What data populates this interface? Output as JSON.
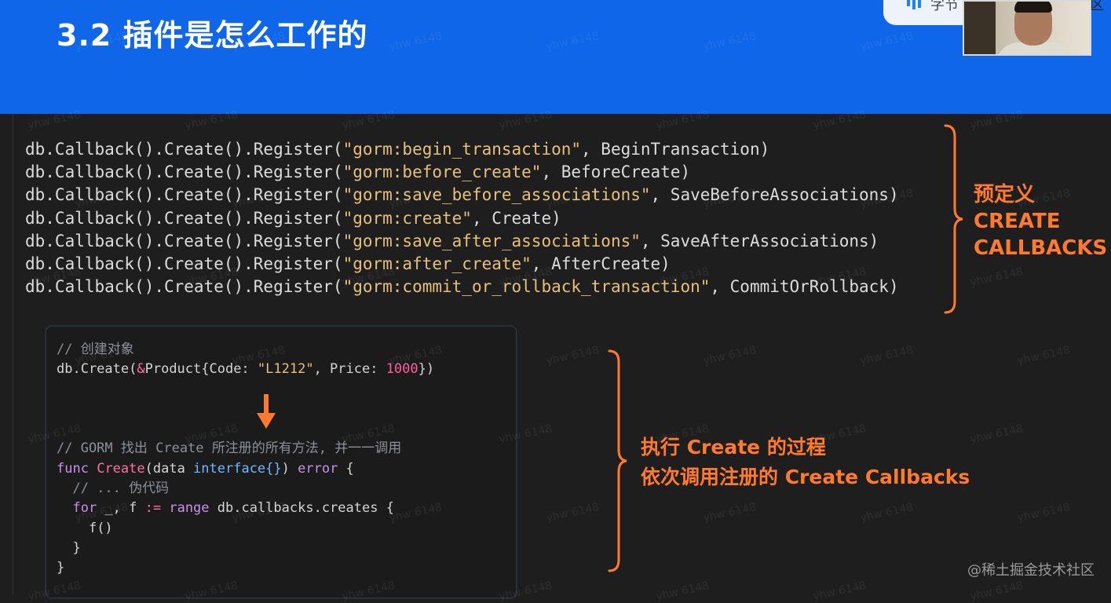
{
  "slide": {
    "title": "3.2 插件是怎么工作的"
  },
  "header": {
    "logo_text": "字节",
    "logo_text_right": "区"
  },
  "registrations": [
    {
      "prefix": "db.Callback().Create().Register(",
      "name": "\"gorm:begin_transaction\"",
      "handler": ", BeginTransaction)"
    },
    {
      "prefix": "db.Callback().Create().Register(",
      "name": "\"gorm:before_create\"",
      "handler": ", BeforeCreate)"
    },
    {
      "prefix": "db.Callback().Create().Register(",
      "name": "\"gorm:save_before_associations\"",
      "handler": ", SaveBeforeAssociations)"
    },
    {
      "prefix": "db.Callback().Create().Register(",
      "name": "\"gorm:create\"",
      "handler": ", Create)"
    },
    {
      "prefix": "db.Callback().Create().Register(",
      "name": "\"gorm:save_after_associations\"",
      "handler": ", SaveAfterAssociations)"
    },
    {
      "prefix": "db.Callback().Create().Register(",
      "name": "\"gorm:after_create\"",
      "handler": ", AfterCreate)"
    },
    {
      "prefix": "db.Callback().Create().Register(",
      "name": "\"gorm:commit_or_rollback_transaction\"",
      "handler": ", CommitOrRollback)"
    }
  ],
  "annotations": {
    "predefined_line1": "预定义",
    "predefined_line2": "CREATE",
    "predefined_line3": "CALLBACKS",
    "process_line1": "执行 Create 的过程",
    "process_line2": "依次调用注册的 Create Callbacks"
  },
  "example": {
    "comment_create": "// 创建对象",
    "create_call_prefix": "db.Create(",
    "create_amp": "&",
    "create_struct": "Product{Code: ",
    "create_code": "\"L1212\"",
    "create_mid": ", Price: ",
    "create_price": "1000",
    "create_suffix": "})",
    "comment_find": "// GORM 找出 Create 所注册的所有方法, 并一一调用",
    "func_kw": "func",
    "func_name": "Create",
    "func_param": "(data ",
    "func_iface": "interface{}",
    "func_close": ") ",
    "func_ret": "error",
    "func_open": " {",
    "pseudo_comment": "// ... 伪代码",
    "for_kw": "for",
    "for_vars": " _, f ",
    "for_assign": ":=",
    "for_range": " range",
    "for_rest": " db.callbacks.creates {",
    "call": "f()",
    "close_inner": "}",
    "close_outer": "}"
  },
  "watermark": {
    "user": "yhw 6148",
    "site": "@稀土掘金技术社区"
  },
  "colors": {
    "blue_band": "#0f66e8",
    "accent_orange": "#ff7a2e",
    "string_yellow": "#e6c07b",
    "keyword_purple": "#c792ea"
  }
}
